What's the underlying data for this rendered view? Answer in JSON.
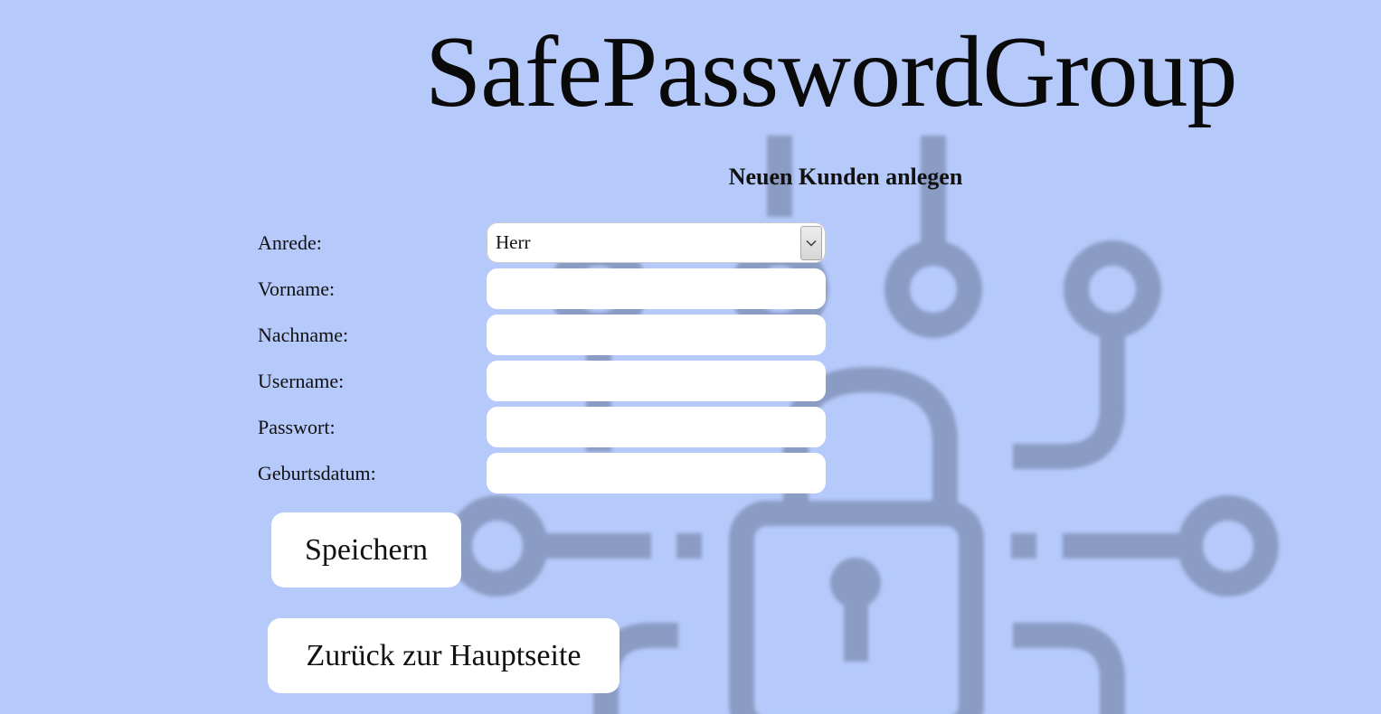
{
  "app": {
    "title": "SafePasswordGroup",
    "subtitle": "Neuen Kunden anlegen"
  },
  "form": {
    "anrede": {
      "label": "Anrede:",
      "value": "Herr",
      "icon": "chevron-down-icon"
    },
    "vorname": {
      "label": "Vorname:",
      "value": ""
    },
    "nachname": {
      "label": "Nachname:",
      "value": ""
    },
    "username": {
      "label": "Username:",
      "value": ""
    },
    "passwort": {
      "label": "Passwort:",
      "value": ""
    },
    "geburtsdatum": {
      "label": "Geburtsdatum:",
      "value": ""
    }
  },
  "buttons": {
    "save": "Speichern",
    "back": "Zurück zur Hauptseite"
  },
  "background": {
    "icon": "circuit-padlock-icon"
  },
  "colors": {
    "background": "#b5cafa",
    "artwork": "#8a9bc4",
    "field": "#ffffff"
  }
}
